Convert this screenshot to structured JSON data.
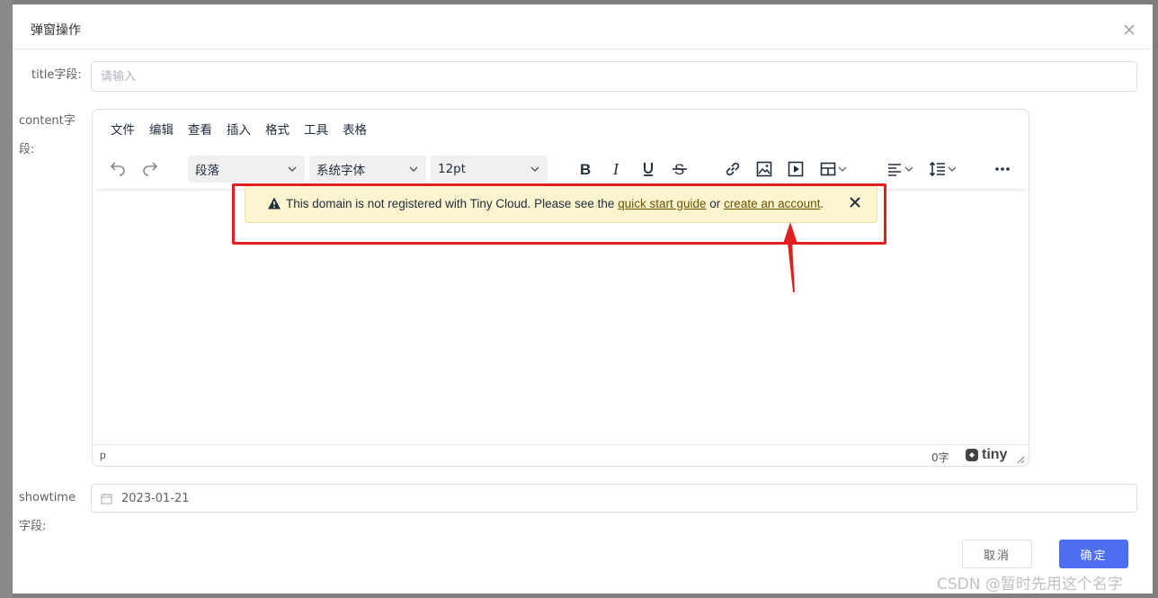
{
  "dialog": {
    "title": "弹窗操作"
  },
  "form": {
    "title_label": "title字段:",
    "title_placeholder": "请输入",
    "content_label_line1": "content字",
    "content_label_line2": "段:",
    "showtime_label_line1": "showtime",
    "showtime_label_line2": "字段:",
    "showtime_value": "2023-01-21"
  },
  "editor": {
    "menus": [
      "文件",
      "编辑",
      "查看",
      "插入",
      "格式",
      "工具",
      "表格"
    ],
    "block_format": "段落",
    "font_family": "系统字体",
    "font_size": "12pt",
    "status_path": "p",
    "word_count": "0字",
    "brand": "tiny"
  },
  "notice": {
    "text_before": "This domain is not registered with Tiny Cloud. Please see the",
    "link1": "quick start guide",
    "text_middle": "or",
    "link2": "create an account",
    "text_after": "."
  },
  "buttons": {
    "cancel": "取消",
    "confirm": "确定"
  },
  "watermark": "CSDN @暂时先用这个名字",
  "colors": {
    "primary": "#4e6ef2",
    "notice_bg": "#fcf3cf",
    "highlight": "#e02020"
  }
}
